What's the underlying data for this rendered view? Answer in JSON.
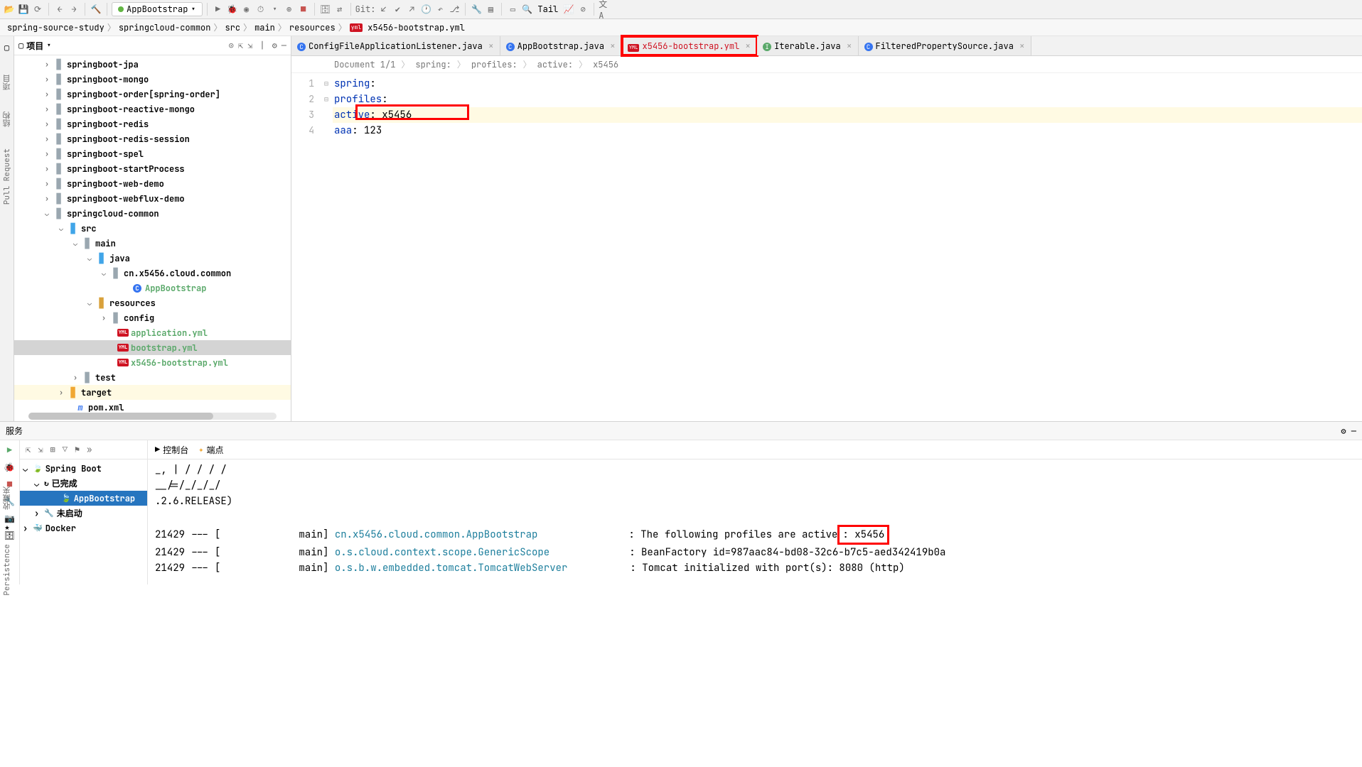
{
  "toolbar": {
    "run_config": "AppBootstrap",
    "git_label": "Git:",
    "tail_label": "Tail"
  },
  "breadcrumb": [
    "spring-source-study",
    "springcloud-common",
    "src",
    "main",
    "resources",
    "x5456-bootstrap.yml"
  ],
  "project_panel": {
    "title": "项目"
  },
  "tree": [
    {
      "pad": 40,
      "arrow": "›",
      "icon": "📁",
      "label": "springboot-jpa",
      "cls": "tree-normal"
    },
    {
      "pad": 40,
      "arrow": "›",
      "icon": "📁",
      "label": "springboot-mongo",
      "cls": "tree-normal"
    },
    {
      "pad": 40,
      "arrow": "›",
      "icon": "📁",
      "label": "springboot-order",
      "extra": " [spring-order]",
      "cls": "tree-normal"
    },
    {
      "pad": 40,
      "arrow": "›",
      "icon": "📁",
      "label": "springboot-reactive-mongo",
      "cls": "tree-normal"
    },
    {
      "pad": 40,
      "arrow": "›",
      "icon": "📁",
      "label": "springboot-redis",
      "cls": "tree-normal"
    },
    {
      "pad": 40,
      "arrow": "›",
      "icon": "📁",
      "label": "springboot-redis-session",
      "cls": "tree-normal"
    },
    {
      "pad": 40,
      "arrow": "›",
      "icon": "📁",
      "label": "springboot-spel",
      "cls": "tree-normal"
    },
    {
      "pad": 40,
      "arrow": "›",
      "icon": "📁",
      "label": "springboot-startProcess",
      "cls": "tree-normal"
    },
    {
      "pad": 40,
      "arrow": "›",
      "icon": "📁",
      "label": "springboot-web-demo",
      "cls": "tree-normal"
    },
    {
      "pad": 40,
      "arrow": "›",
      "icon": "📁",
      "label": "springboot-webflux-demo",
      "cls": "tree-normal"
    },
    {
      "pad": 40,
      "arrow": "⌄",
      "icon": "📁",
      "label": "springcloud-common",
      "cls": "tree-normal"
    },
    {
      "pad": 60,
      "arrow": "⌄",
      "icon": "📂",
      "label": "src",
      "cls": "tree-normal",
      "folder": "blue"
    },
    {
      "pad": 80,
      "arrow": "⌄",
      "icon": "📂",
      "label": "main",
      "cls": "tree-normal",
      "folder": "gray"
    },
    {
      "pad": 100,
      "arrow": "⌄",
      "icon": "📂",
      "label": "java",
      "cls": "tree-normal",
      "folder": "blue"
    },
    {
      "pad": 120,
      "arrow": "⌄",
      "icon": "📁",
      "label": "cn.x5456.cloud.common",
      "cls": "tree-normal",
      "folder": "gray"
    },
    {
      "pad": 150,
      "arrow": "",
      "icon": "Ⓒ",
      "label": "AppBootstrap",
      "cls": "tree-green-text"
    },
    {
      "pad": 100,
      "arrow": "⌄",
      "icon": "📂",
      "label": "resources",
      "cls": "tree-normal",
      "folder": "yellow"
    },
    {
      "pad": 120,
      "arrow": "›",
      "icon": "📂",
      "label": "config",
      "cls": "tree-normal",
      "folder": "gray"
    },
    {
      "pad": 130,
      "arrow": "",
      "icon": "yml",
      "label": "application.yml",
      "cls": "tree-green-text"
    },
    {
      "pad": 130,
      "arrow": "",
      "icon": "yml",
      "label": "bootstrap.yml",
      "cls": "tree-green-text",
      "selected": true
    },
    {
      "pad": 130,
      "arrow": "",
      "icon": "yml",
      "label": "x5456-bootstrap.yml",
      "cls": "tree-green-text"
    },
    {
      "pad": 80,
      "arrow": "›",
      "icon": "📂",
      "label": "test",
      "cls": "tree-normal",
      "folder": "gray"
    },
    {
      "pad": 60,
      "arrow": "›",
      "icon": "📂",
      "label": "target",
      "cls": "tree-normal",
      "folder": "orange",
      "target": true
    },
    {
      "pad": 70,
      "arrow": "",
      "icon": "m",
      "label": "pom.xml",
      "cls": "tree-normal",
      "pom": true
    }
  ],
  "tabs": [
    {
      "icon": "C",
      "label": "ConfigFileApplicationListener.java"
    },
    {
      "icon": "C",
      "label": "AppBootstrap.java"
    },
    {
      "icon": "yml",
      "label": "x5456-bootstrap.yml",
      "highlighted": true,
      "color": "#cf1322"
    },
    {
      "icon": "I",
      "label": "Iterable.java",
      "iconColor": "#59a869"
    },
    {
      "icon": "C",
      "label": "FilteredPropertySource.java"
    }
  ],
  "editor_bc": [
    "Document 1/1",
    "spring:",
    "profiles:",
    "active:",
    "x5456"
  ],
  "code": {
    "lines": [
      {
        "n": 1,
        "text": [
          {
            "t": "spring",
            "c": "kw"
          },
          {
            "t": ":"
          }
        ]
      },
      {
        "n": 2,
        "text": [
          {
            "t": "  "
          },
          {
            "t": "profiles",
            "c": "kw"
          },
          {
            "t": ":"
          }
        ]
      },
      {
        "n": 3,
        "hl": true,
        "text": [
          {
            "t": "    "
          },
          {
            "t": "active",
            "c": "kw"
          },
          {
            "t": ": "
          },
          {
            "t": "x5456"
          }
        ]
      },
      {
        "n": 4,
        "text": [
          {
            "t": "aaa",
            "c": "kw"
          },
          {
            "t": ": "
          },
          {
            "t": "123"
          }
        ]
      }
    ]
  },
  "services": {
    "title": "服务",
    "tree": [
      {
        "label": "Spring Boot",
        "arrow": "⌄",
        "icon": "🍃"
      },
      {
        "label": "已完成",
        "arrow": "⌄",
        "icon": "↻",
        "pad": 16
      },
      {
        "label": "AppBootstrap",
        "selected": true,
        "icon": "🍃",
        "pad": 40
      },
      {
        "label": "未启动",
        "arrow": "›",
        "icon": "🔧",
        "pad": 16
      },
      {
        "label": "Docker",
        "arrow": "›",
        "icon": "🐳",
        "pad": 0
      }
    ],
    "console_tabs": [
      "控制台",
      "端点"
    ],
    "banner": [
      "_, | / / / /",
      "__/=/_/_/_/",
      ".2.6.RELEASE)"
    ],
    "log": [
      {
        "ts": "21429 --- [",
        "th": "main] ",
        "cls": "cn.x5456.cloud.common.AppBootstrap",
        "msg": ": The following profiles are active",
        "active": ": x5456"
      },
      {
        "ts": "21429 --- [",
        "th": "main] ",
        "cls": "o.s.cloud.context.scope.GenericScope",
        "msg": ": BeanFactory id=987aac84-bd08-32c6-b7c5-aed342419b0a"
      },
      {
        "ts": "21429 --- [",
        "th": "main] ",
        "cls": "o.s.b.w.embedded.tomcat.TomcatWebServer",
        "msg": ": Tomcat initialized with port(s): 8080 (http)"
      }
    ]
  },
  "left_gutter": [
    "项目",
    "结构",
    "Pull Request"
  ],
  "left_extra": [
    "收藏夹",
    "Persistence"
  ]
}
